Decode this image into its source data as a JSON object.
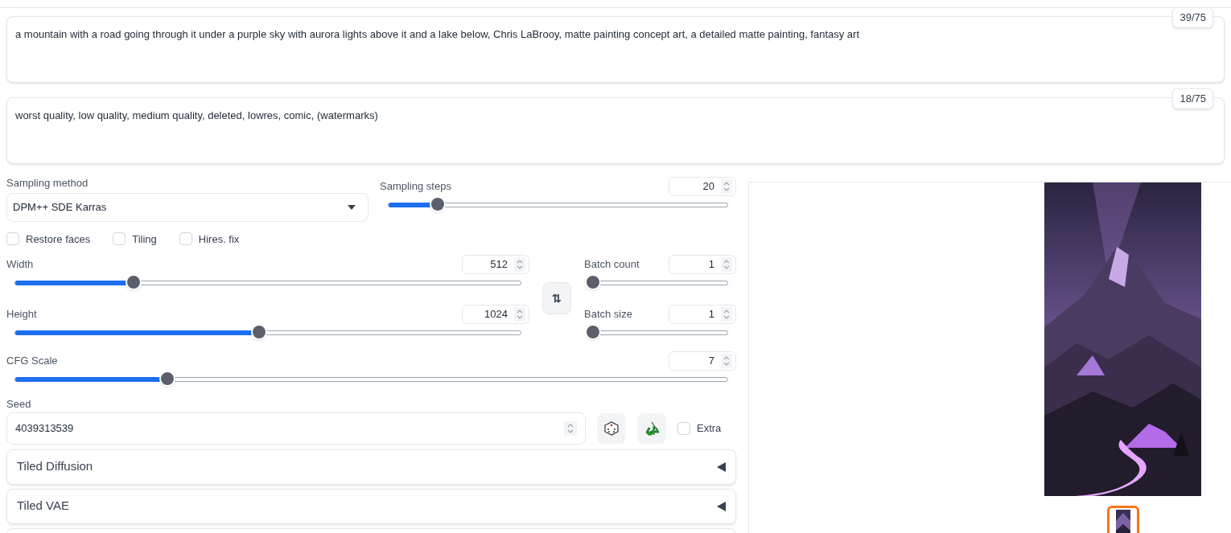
{
  "prompts": [
    {
      "value": "a mountain with a road going through it under a purple sky with aurora lights above it and a lake below, Chris LaBrooy, matte painting concept art, a detailed matte painting, fantasy art",
      "counter": "39/75"
    },
    {
      "value": "worst quality, low quality, medium quality, deleted, lowres, comic, (watermarks)",
      "counter": "18/75"
    }
  ],
  "sampling_method": {
    "label": "Sampling method",
    "value": "DPM++ SDE Karras"
  },
  "sampling_steps": {
    "label": "Sampling steps",
    "value": "20",
    "level": 0.144
  },
  "checkboxes": [
    {
      "label": "Restore faces",
      "checked": false
    },
    {
      "label": "Tiling",
      "checked": false
    },
    {
      "label": "Hires. fix",
      "checked": false
    }
  ],
  "width": {
    "label": "Width",
    "value": "512",
    "level": 0.234
  },
  "height": {
    "label": "Height",
    "value": "1024",
    "level": 0.483
  },
  "swap_button": {
    "label": "⇅"
  },
  "batch_count": {
    "label": "Batch count",
    "value": "1",
    "level": 0
  },
  "batch_size": {
    "label": "Batch size",
    "value": "1",
    "level": 0
  },
  "cfg_scale": {
    "label": "CFG Scale",
    "value": "7",
    "level": 0.213
  },
  "seed": {
    "label": "Seed",
    "value": "4039313539",
    "extra": {
      "label": "Extra",
      "checked": false
    }
  },
  "accordions": [
    {
      "title": "Tiled Diffusion",
      "expanded": false
    },
    {
      "title": "Tiled VAE",
      "expanded": false
    }
  ],
  "partial_accordion_below": true,
  "gallery": {
    "thumbnails": [
      {
        "selected": true
      }
    ]
  }
}
